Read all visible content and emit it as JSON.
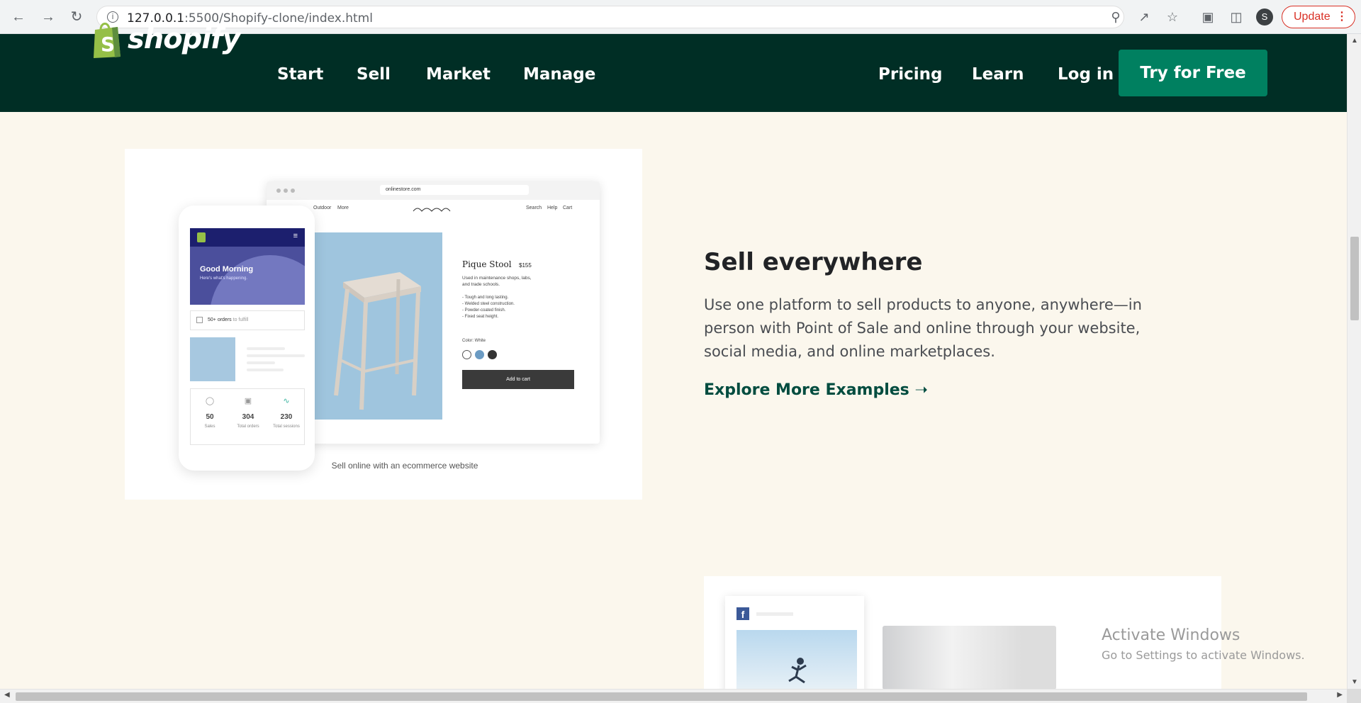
{
  "browser": {
    "url_host": "127.0.0.1",
    "url_rest": ":5500/Shopify-clone/index.html",
    "profile_initial": "S",
    "update_label": "Update"
  },
  "header": {
    "logo_text": "shopify",
    "nav_left": [
      "Start",
      "Sell",
      "Market",
      "Manage"
    ],
    "nav_right": [
      "Pricing",
      "Learn",
      "Log in"
    ],
    "cta": "Try for Free"
  },
  "feature": {
    "title": "Sell everywhere",
    "body": "Use one platform to sell products to anyone, anywhere—in person with Point of Sale and online through your website, social media, and online marketplaces.",
    "link": "Explore More Examples ➝",
    "caption": "Sell online with an ecommerce website"
  },
  "mockup": {
    "store_url": "onlinestore.com",
    "store_nav_left": [
      "Outdoor",
      "More"
    ],
    "store_nav_right": [
      "Search",
      "Help",
      "Cart"
    ],
    "product_title": "Pique Stool",
    "product_price": "$155",
    "product_desc": "Used in maintenance shops, labs, and trade schools.",
    "product_bullets": [
      "- Tough and long lasting.",
      "- Welded steel construction.",
      "- Powder-coated finish.",
      "- Fixed seat height."
    ],
    "color_label": "Color: White",
    "add_to_cart": "Add to cart",
    "phone_greeting": "Good Morning",
    "phone_sub": "Here's what's happening.",
    "phone_orders": "50+ orders",
    "phone_orders_suffix": "to fulfill",
    "stats": [
      {
        "value": "50",
        "label": "Sales"
      },
      {
        "value": "304",
        "label": "Total orders"
      },
      {
        "value": "230",
        "label": "Total sessions"
      }
    ]
  },
  "watermark": {
    "line1": "Activate Windows",
    "line2": "Go to Settings to activate Windows."
  },
  "colors": {
    "header_bg": "#002e25",
    "cta_bg": "#008060",
    "page_bg": "#fbf7ed",
    "link": "#004c3f"
  }
}
